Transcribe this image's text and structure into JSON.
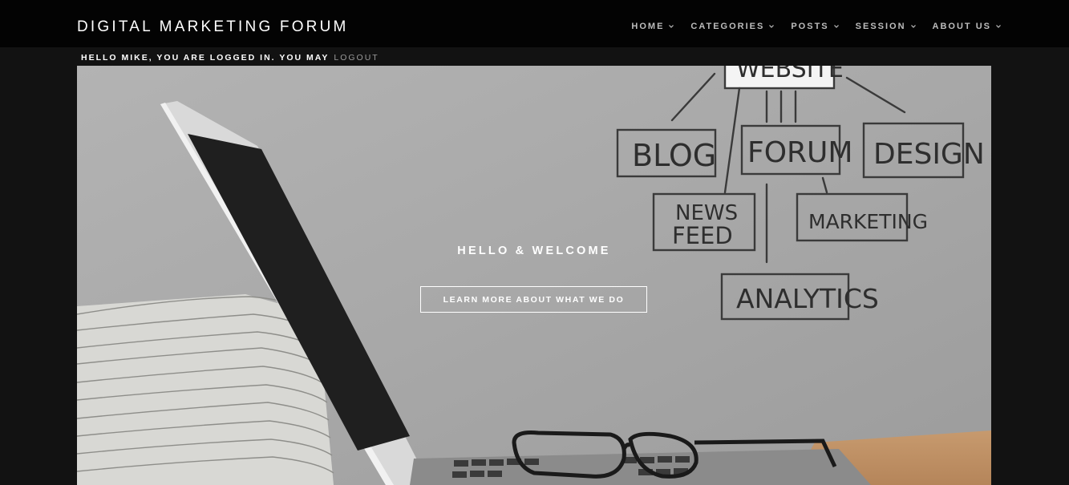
{
  "header": {
    "brand": "DIGITAL MARKETING FORUM",
    "nav": [
      {
        "label": "HOME",
        "icon": "chevron-down-icon"
      },
      {
        "label": "CATEGORIES",
        "icon": "chevron-down-icon"
      },
      {
        "label": "POSTS",
        "icon": "chevron-down-icon"
      },
      {
        "label": "SESSION",
        "icon": "chevron-down-icon"
      },
      {
        "label": "ABOUT US",
        "icon": "chevron-down-icon"
      }
    ]
  },
  "session": {
    "greeting": "HELLO MIKE, YOU ARE LOGGED IN. YOU MAY",
    "logout_label": "LOGOUT"
  },
  "hero": {
    "title": "HELLO & WELCOME",
    "button_label": "LEARN MORE ABOUT WHAT WE DO",
    "sketch_labels": {
      "top": "WEBSITE",
      "blog": "BLOG",
      "forum": "FORUM",
      "design": "DESIGN",
      "news": "NEWS",
      "feed": "FEED",
      "marketing": "MARKETING",
      "analytics": "ANALYTICS"
    }
  },
  "colors": {
    "topbar": "#030303",
    "page_bg": "#121212",
    "hero_bg": "#a9a9a9",
    "text": "#ffffff",
    "nav_text": "#bdbdbd"
  }
}
